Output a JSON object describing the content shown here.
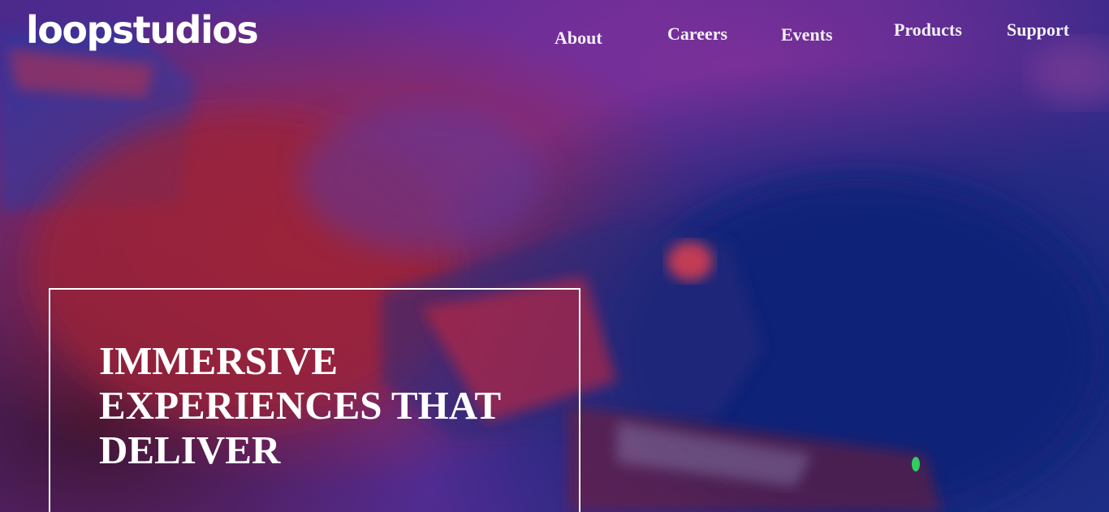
{
  "header": {
    "logo_text": "loopstudios",
    "nav": [
      {
        "label": "About"
      },
      {
        "label": "Careers"
      },
      {
        "label": "Events"
      },
      {
        "label": "Products"
      },
      {
        "label": "Support"
      }
    ]
  },
  "hero": {
    "title": "IMMERSIVE EXPERIENCES THAT DELIVER",
    "background_icon": "vr-headset-photo-icon"
  },
  "colors": {
    "text": "#ffffff",
    "bg_purple": "#5a2a9a",
    "bg_red": "#a3263d",
    "bg_blue": "#14287a"
  }
}
